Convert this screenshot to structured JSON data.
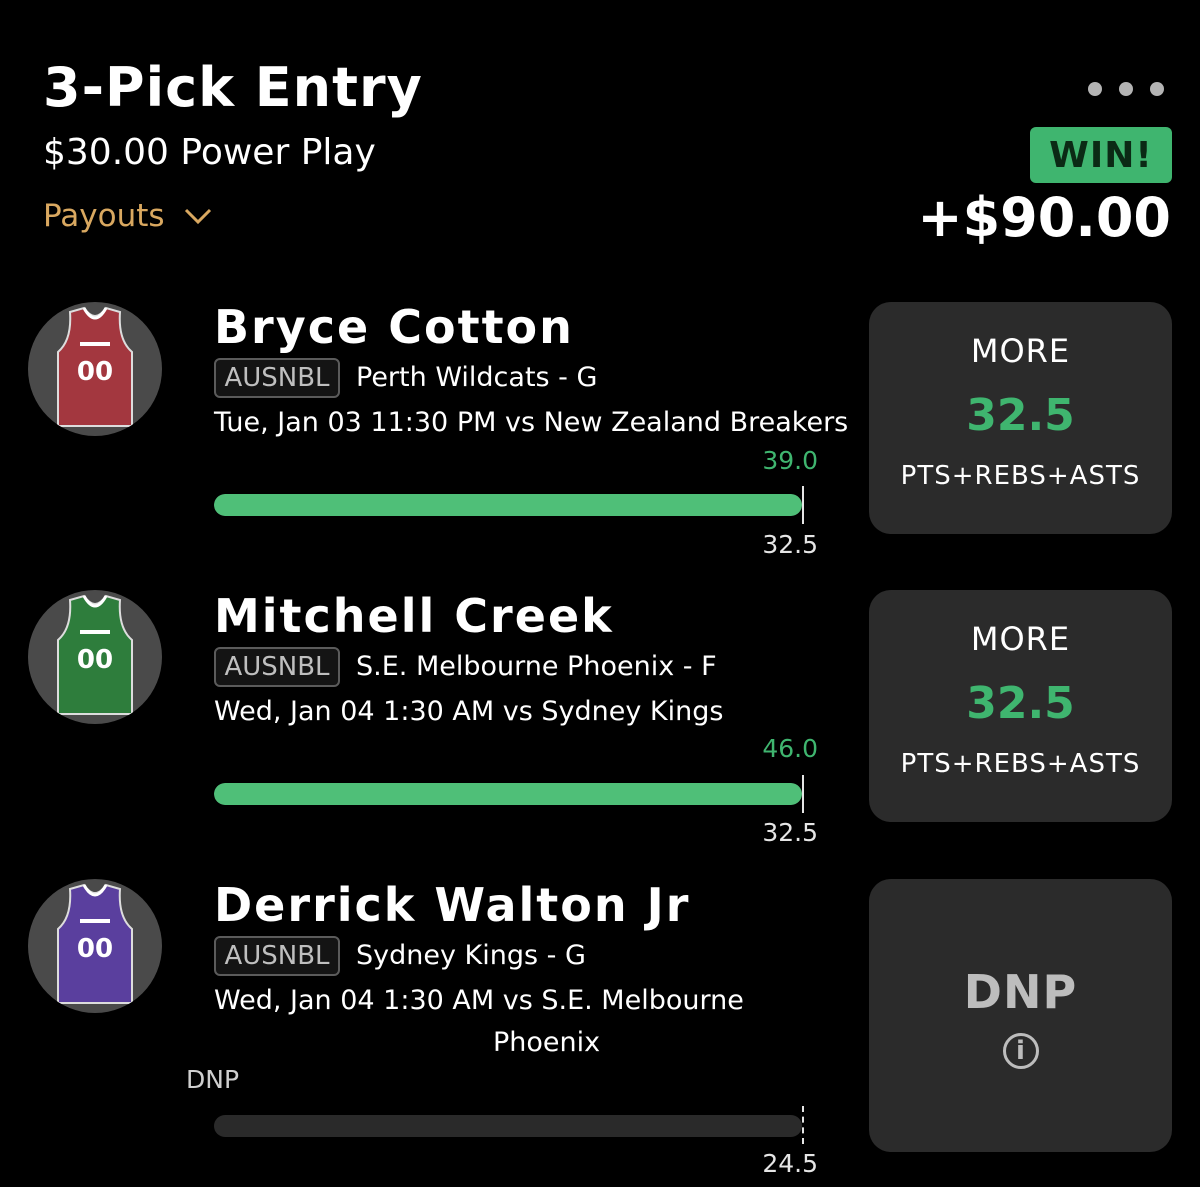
{
  "header": {
    "title": "3-Pick Entry",
    "entry_type": "$30.00 Power Play",
    "payouts_label": "Payouts",
    "result_badge": "WIN!",
    "winnings": "+$90.00"
  },
  "picks": [
    {
      "player": "Bryce Cotton",
      "league": "AUSNBL",
      "team_pos": "Perth Wildcats - G",
      "game_line1": "Tue, Jan 03 11:30 PM  vs New Zealand Breakers",
      "actual": "39.0",
      "line": "32.5",
      "progress": 1.0,
      "direction": "MORE",
      "pick_line": "32.5",
      "stat": "PTS+REBS+ASTS",
      "jersey_color": "#a3373f",
      "jersey_number": "00"
    },
    {
      "player": "Mitchell Creek",
      "league": "AUSNBL",
      "team_pos": "S.E. Melbourne Phoenix - F",
      "game_line1": "Wed, Jan 04 1:30 AM  vs Sydney Kings",
      "actual": "46.0",
      "line": "32.5",
      "progress": 1.0,
      "direction": "MORE",
      "pick_line": "32.5",
      "stat": "PTS+REBS+ASTS",
      "jersey_color": "#2e7d3c",
      "jersey_number": "00"
    },
    {
      "player": "Derrick Walton Jr",
      "league": "AUSNBL",
      "team_pos": "Sydney Kings - G",
      "game_line1": "Wed, Jan 04 1:30 AM  vs S.E. Melbourne",
      "game_line2": "Phoenix",
      "actual": "DNP",
      "line": "24.5",
      "progress": 0,
      "status": "DNP",
      "jersey_color": "#5a3f9e",
      "jersey_number": "00"
    }
  ],
  "icons": {
    "menu": "more-dots-icon",
    "payouts": "chevron-down-icon",
    "info": "info-icon"
  },
  "colors": {
    "accent_green": "#3fb56f",
    "payouts_gold": "#d9a860",
    "card_bg": "#2b2b2b"
  }
}
